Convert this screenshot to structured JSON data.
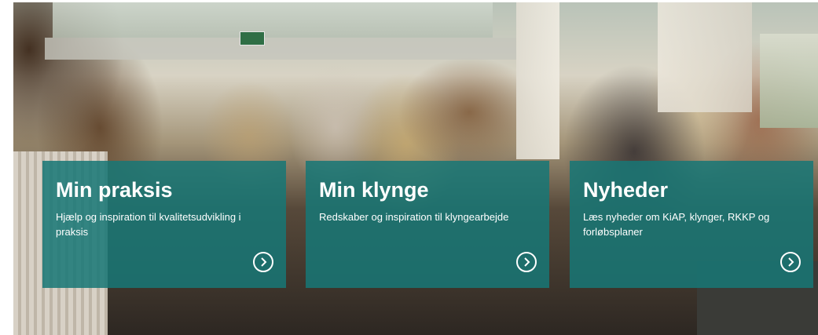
{
  "hero": {
    "icons": {
      "background": "photo-crowd",
      "arrow": "chevron-right-circle-icon"
    },
    "accent_color": "#177776"
  },
  "cards": [
    {
      "title": "Min praksis",
      "description": "Hjælp og inspiration til kvalitetsudvikling i praksis"
    },
    {
      "title": "Min klynge",
      "description": "Redskaber og inspiration til klyngearbejde"
    },
    {
      "title": "Nyheder",
      "description": "Læs nyheder om KiAP, klynger, RKKP og forløbsplaner"
    }
  ]
}
